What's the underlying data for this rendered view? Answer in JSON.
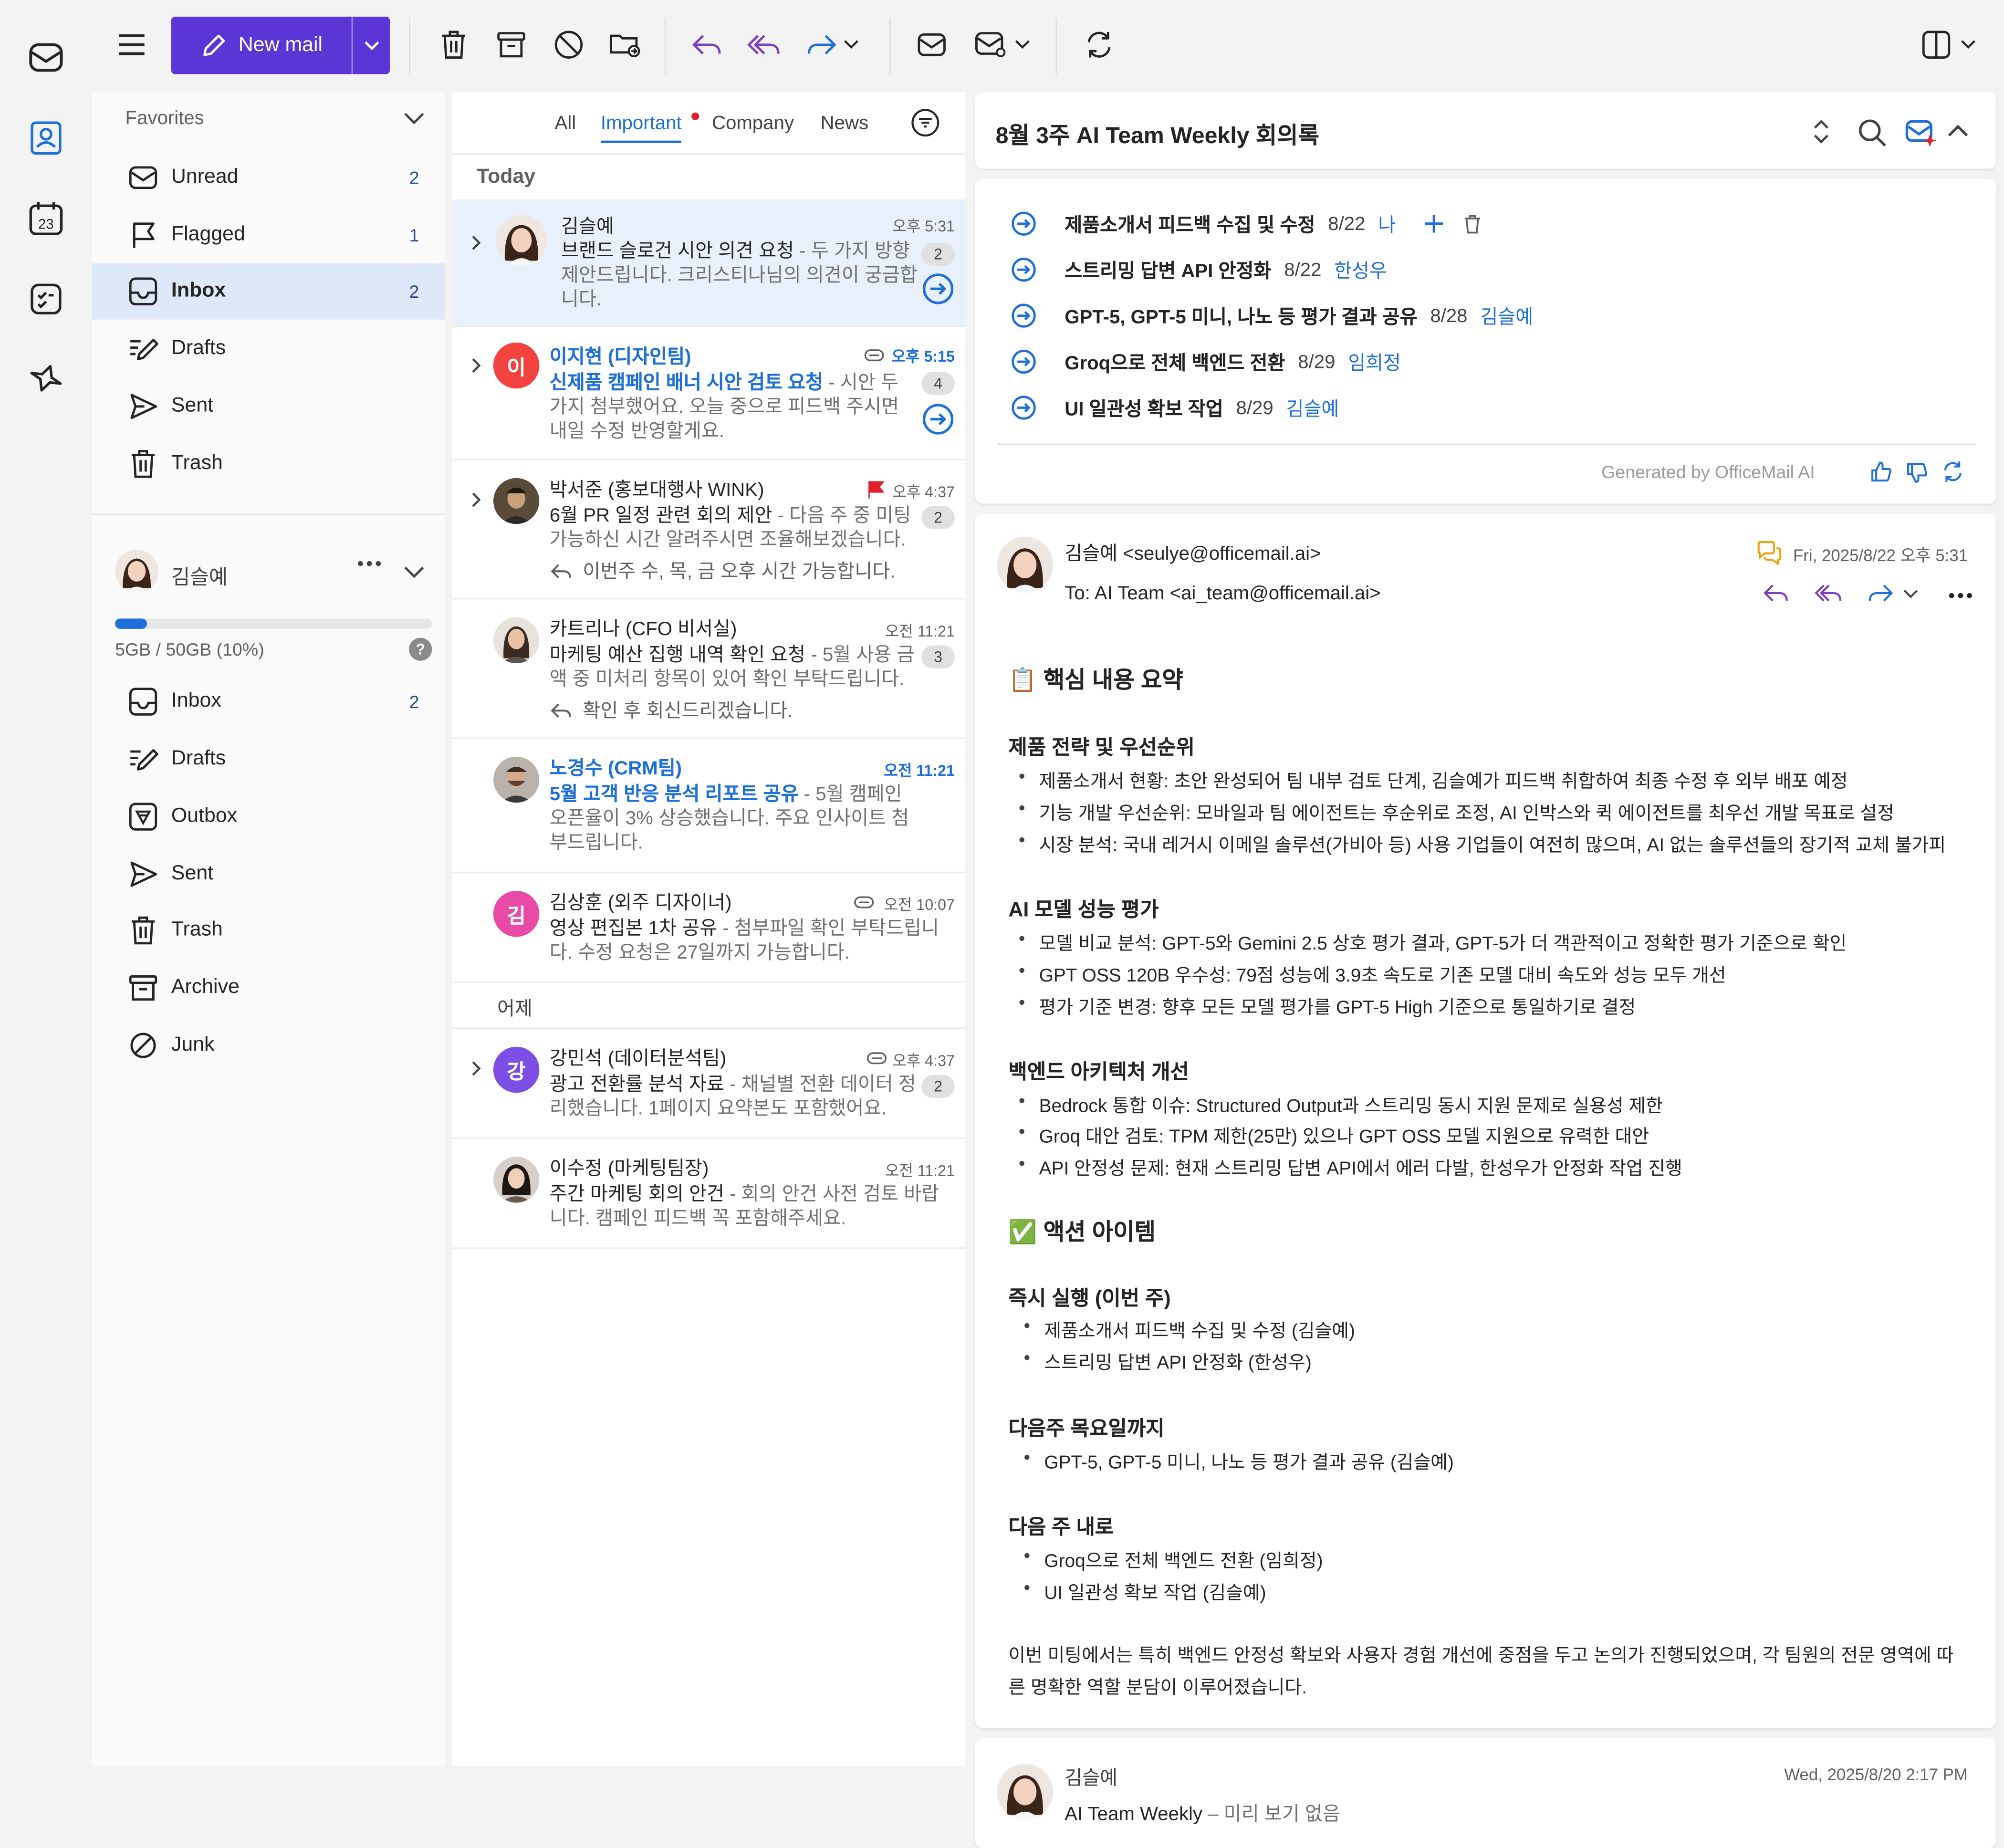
{
  "toolbar": {
    "new_mail_label": "New mail"
  },
  "favorites": {
    "header": "Favorites",
    "items": [
      {
        "label": "Unread",
        "count": "2"
      },
      {
        "label": "Flagged",
        "count": "1"
      },
      {
        "label": "Inbox",
        "count": "2"
      },
      {
        "label": "Drafts",
        "count": ""
      },
      {
        "label": "Sent",
        "count": ""
      },
      {
        "label": "Trash",
        "count": ""
      }
    ]
  },
  "account": {
    "name": "김슬예",
    "storage_text": "5GB / 50GB (10%)",
    "storage_fraction": 0.1,
    "help": "?",
    "folders": [
      {
        "label": "Inbox",
        "count": "2"
      },
      {
        "label": "Drafts",
        "count": ""
      },
      {
        "label": "Outbox",
        "count": ""
      },
      {
        "label": "Sent",
        "count": ""
      },
      {
        "label": "Trash",
        "count": ""
      },
      {
        "label": "Archive",
        "count": ""
      },
      {
        "label": "Junk",
        "count": ""
      }
    ]
  },
  "rail": {
    "calendar_day": "23"
  },
  "list": {
    "tabs": [
      "All",
      "Important",
      "Company",
      "News"
    ],
    "group_today": "Today",
    "group_yesterday": "어제",
    "messages": [
      {
        "from": "김슬예",
        "time": "오후 5:31",
        "subject": "브랜드 슬로건 시안 의견 요청",
        "preview": " - 두 가지 방향 제안드립니다. 크리스티나님의 의견이 궁금합니다.",
        "count": "2"
      },
      {
        "from": "이지현 (디자인팀)",
        "time": "오후 5:15",
        "subject": "신제품 캠페인 배너 시안 검토 요청",
        "preview": " - 시안 두 가지 첨부했어요. 오늘 중으로 피드백 주시면 내일 수정 반영할게요.",
        "count": "4",
        "avatar_letter": "이"
      },
      {
        "from": "박서준 (홍보대행사 WINK)",
        "time": "오후 4:37",
        "subject": "6월 PR 일정 관련 회의 제안",
        "preview": " - 다음 주 중 미팅 가능하신 시간 알려주시면 조율해보겠습니다.",
        "count": "2",
        "reply": "이번주 수, 목, 금 오후 시간 가능합니다."
      },
      {
        "from": "카트리나 (CFO 비서실)",
        "time": "오전 11:21",
        "subject": "마케팅 예산 집행 내역 확인 요청",
        "preview": " - 5월 사용 금액 중 미처리 항목이 있어 확인 부탁드립니다.",
        "count": "3",
        "reply": "확인 후 회신드리겠습니다."
      },
      {
        "from": "노경수 (CRM팀)",
        "time": "오전 11:21",
        "subject": "5월 고객 반응 분석 리포트 공유",
        "preview": " - 5월 캠페인 오픈율이 3% 상승했습니다. 주요 인사이트 첨부드립니다."
      },
      {
        "from": "김상훈 (외주 디자이너)",
        "time": "오전 10:07",
        "subject": "영상 편집본 1차 공유",
        "preview": " - 첨부파일 확인 부탁드립니다. 수정 요청은 27일까지 가능합니다.",
        "avatar_letter": "김"
      },
      {
        "from": "강민석 (데이터분석팀)",
        "time": "오후 4:37",
        "subject": "광고 전환률 분석 자료",
        "preview": " - 채널별 전환 데이터 정리했습니다. 1페이지 요약본도 포함했어요.",
        "count": "2",
        "avatar_letter": "강"
      },
      {
        "from": "이수정 (마케팅팀장)",
        "time": "오전 11:21",
        "subject": "주간 마케팅 회의 안건",
        "preview": " - 회의 안건 사전 검토 바랍니다. 캠페인 피드백 꼭 포함해주세요."
      }
    ]
  },
  "reading": {
    "subject": "8월 3주 AI Team Weekly 회의록",
    "tasks": [
      {
        "title": "제품소개서 피드백 수집 및 수정",
        "date": "8/22",
        "owner": "나"
      },
      {
        "title": "스트리밍 답변 API 안정화",
        "date": "8/22",
        "owner": "한성우"
      },
      {
        "title": "GPT-5, GPT-5 미니, 나노 등 평가 결과 공유",
        "date": "8/28",
        "owner": "김슬예"
      },
      {
        "title": "Groq으로 전체 백엔드 전환",
        "date": "8/29",
        "owner": "임희정"
      },
      {
        "title": "UI 일관성 확보 작업",
        "date": "8/29",
        "owner": "김슬예"
      }
    ],
    "generated_by": "Generated by OfficeMail AI",
    "email": {
      "from": "김슬예 <seulye@officemail.ai>",
      "to": "To:  AI Team <ai_team@officemail.ai>",
      "date": "Fri, 2025/8/22 오후 5:31",
      "summary_title": "📋 핵심 내용 요약",
      "sections": [
        {
          "title": "제품 전략 및 우선순위",
          "items": [
            "제품소개서 현황: 초안 완성되어 팀 내부 검토 단계, 김슬예가 피드백 취합하여 최종 수정 후 외부 배포 예정",
            "기능 개발 우선순위: 모바일과 팀 에이전트는 후순위로 조정, AI 인박스와 퀵 에이전트를 최우선 개발 목표로 설정",
            "시장 분석: 국내 레거시 이메일 솔루션(가비아 등) 사용 기업들이 여전히 많으며, AI 없는 솔루션들의 장기적 교체 불가피"
          ]
        },
        {
          "title": "AI 모델 성능 평가",
          "items": [
            "모델 비교 분석: GPT-5와 Gemini 2.5 상호 평가 결과, GPT-5가 더 객관적이고 정확한 평가 기준으로 확인",
            "GPT OSS 120B 우수성: 79점 성능에 3.9초 속도로 기존 모델 대비 속도와 성능 모두 개선",
            "평가 기준 변경: 향후 모든 모델 평가를 GPT-5 High 기준으로 통일하기로 결정"
          ]
        },
        {
          "title": "백엔드 아키텍처 개선",
          "items": [
            "Bedrock 통합 이슈: Structured Output과 스트리밍 동시 지원 문제로 실용성 제한",
            "Groq 대안 검토: TPM 제한(25만) 있으나 GPT OSS 모델 지원으로 유력한 대안",
            "API 안정성 문제: 현재 스트리밍 답변 API에서 에러 다발, 한성우가 안정화 작업 진행"
          ]
        }
      ],
      "action_title": "✅ 액션 아이템",
      "actions": [
        {
          "title": "즉시 실행 (이번 주)",
          "items": [
            "제품소개서 피드백 수집 및 수정 (김슬예)",
            "스트리밍 답변 API 안정화 (한성우)"
          ]
        },
        {
          "title": "다음주 목요일까지",
          "items": [
            "GPT-5, GPT-5 미니, 나노 등 평가 결과 공유 (김슬예)"
          ]
        },
        {
          "title": "다음 주 내로",
          "items": [
            "Groq으로 전체 백엔드 전환 (임희정)",
            "UI 일관성 확보 작업 (김슬예)"
          ]
        }
      ],
      "closing": "이번 미팅에서는 특히 백엔드 안정성 확보와 사용자 경험 개선에 중점을 두고 논의가 진행되었으며, 각 팀원의 전문 영역에 따른 명확한 역할 분담이 이루어졌습니다."
    },
    "previous": {
      "from": "김슬예",
      "date": "Wed, 2025/8/20 2:17 PM",
      "subject": "AI Team Weekly",
      "preview": " – 미리 보기 없음"
    }
  },
  "colors": {
    "accent": "#1e6fd9",
    "new_mail": "#5b35d5",
    "selected": "#dde8f8",
    "flag": "#e0202a"
  }
}
